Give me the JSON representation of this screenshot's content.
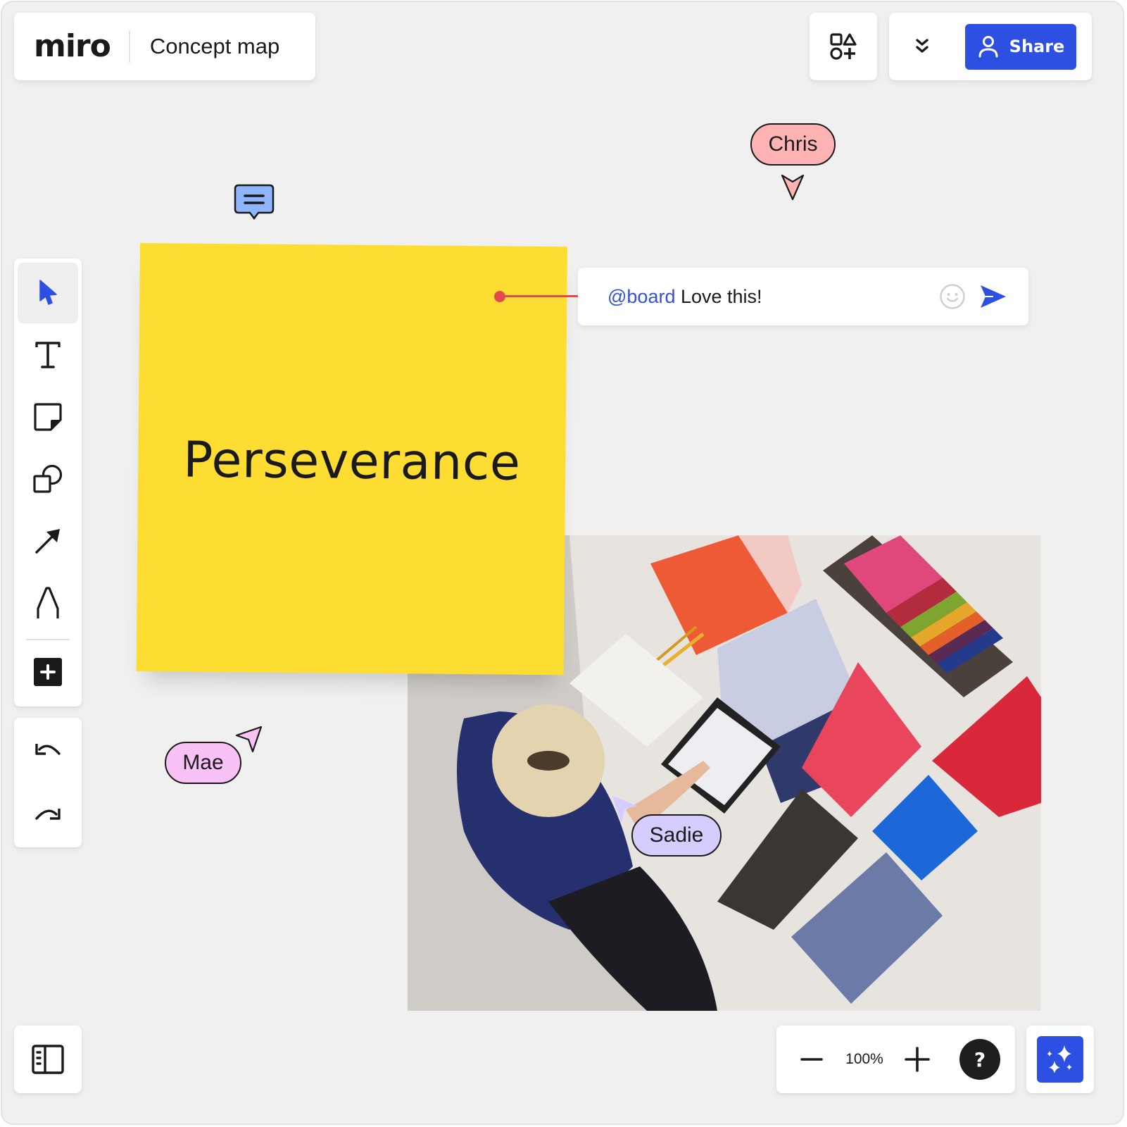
{
  "header": {
    "logo": "miro",
    "board_title": "Concept map"
  },
  "top_right": {
    "shapes_icon": "shapes-templates-icon",
    "expand_icon": "chevron-double-down-icon",
    "share_label": "Share",
    "share_icon": "user-icon"
  },
  "toolbar": {
    "tools": [
      {
        "name": "select",
        "icon": "cursor-icon",
        "active": true
      },
      {
        "name": "text",
        "icon": "text-icon"
      },
      {
        "name": "sticky-note",
        "icon": "sticky-note-icon"
      },
      {
        "name": "shapes",
        "icon": "shapes-icon"
      },
      {
        "name": "connection-line",
        "icon": "arrow-icon"
      },
      {
        "name": "pen",
        "icon": "pen-icon"
      },
      {
        "name": "more-apps",
        "icon": "plus-icon"
      }
    ],
    "history": [
      {
        "name": "undo",
        "icon": "undo-icon"
      },
      {
        "name": "redo",
        "icon": "redo-icon"
      }
    ]
  },
  "canvas": {
    "sticky_note": {
      "text": "Perseverance",
      "color": "#fedd33"
    },
    "comment": {
      "mention": "@board",
      "text": " Love this!",
      "emoji_icon": "smiley-icon",
      "send_icon": "send-icon"
    },
    "cursors": [
      {
        "name": "Chris",
        "color": "#ffb3b3"
      },
      {
        "name": "Mae",
        "color": "#f9c2f6"
      },
      {
        "name": "Sadie",
        "color": "#d6ccff"
      }
    ],
    "comment_marker_icon": "comment-bubble-icon",
    "image": {
      "alt": "Designer working on a tablet with material samples"
    }
  },
  "bottom": {
    "sidebar_icon": "sidebar-panel-icon",
    "zoom_level": "100%",
    "zoom_out_icon": "minus-icon",
    "zoom_in_icon": "plus-icon",
    "help_label": "?",
    "ai_icon": "sparkles-icon"
  },
  "colors": {
    "accent": "#2d4fe2",
    "canvas_bg": "#f0f0f0",
    "connector": "#e5484d",
    "mention": "#3451d1"
  }
}
